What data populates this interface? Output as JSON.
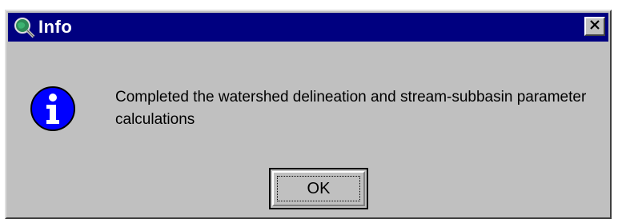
{
  "window": {
    "title": "Info",
    "app_icon": "globe-magnifier-icon",
    "close_icon": "close-icon"
  },
  "message": {
    "icon": "info-icon",
    "text": "Completed the watershed delineation and stream-subbasin parameter calculations"
  },
  "buttons": {
    "ok_label": "OK"
  },
  "colors": {
    "titlebar": "#000080",
    "dialog_bg": "#c0c0c0",
    "info_blue": "#0000ff"
  }
}
